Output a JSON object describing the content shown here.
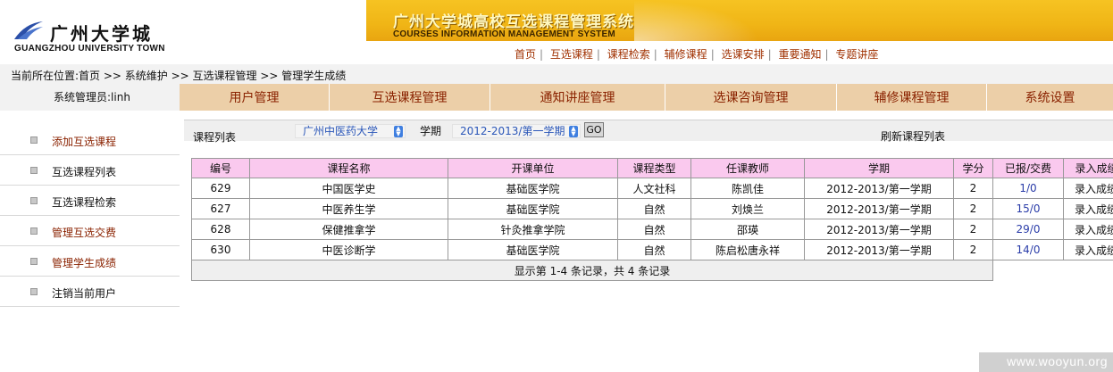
{
  "logo": {
    "cn": "广州大学城",
    "en": "GUANGZHOU UNIVERSITY TOWN"
  },
  "system": {
    "title": "广州大学城高校互选课程管理系统",
    "subtitle": "COURSES INFORMATION MANAGEMENT SYSTEM"
  },
  "top_nav": [
    "首页",
    "互选课程",
    "课程检索",
    "辅修课程",
    "选课安排",
    "重要通知",
    "专题讲座"
  ],
  "breadcrumb": "当前所在位置:首页 >> 系统维护 >> 互选课程管理 >> 管理学生成绩",
  "admin_label": "系统管理员:linh",
  "sidebar": {
    "items": [
      {
        "label": "添加互选课程"
      },
      {
        "label": "互选课程列表"
      },
      {
        "label": "互选课程检索"
      },
      {
        "label": "管理互选交费"
      },
      {
        "label": "管理学生成绩"
      },
      {
        "label": "注销当前用户"
      }
    ]
  },
  "main_tabs": [
    "用户管理",
    "互选课程管理",
    "通知讲座管理",
    "选课咨询管理",
    "辅修课程管理",
    "系统设置"
  ],
  "filter": {
    "list_label": "课程列表",
    "school_value": "广州中医药大学",
    "term_label": "学期",
    "term_value": "2012-2013/第一学期",
    "go_label": "GO",
    "refresh_label": "刷新课程列表"
  },
  "table": {
    "headers": [
      "编号",
      "课程名称",
      "开课单位",
      "课程类型",
      "任课教师",
      "学期",
      "学分",
      "已报/交费",
      "录入成绩"
    ],
    "rows": [
      [
        "629",
        "中国医学史",
        "基础医学院",
        "人文社科",
        "陈凯佳",
        "2012-2013/第一学期",
        "2",
        "1/0",
        "录入成绩"
      ],
      [
        "627",
        "中医养生学",
        "基础医学院",
        "自然",
        "刘焕兰",
        "2012-2013/第一学期",
        "2",
        "15/0",
        "录入成绩"
      ],
      [
        "628",
        "保健推拿学",
        "针灸推拿学院",
        "自然",
        "邵瑛",
        "2012-2013/第一学期",
        "2",
        "29/0",
        "录入成绩"
      ],
      [
        "630",
        "中医诊断学",
        "基础医学院",
        "自然",
        "陈启松唐永祥",
        "2012-2013/第一学期",
        "2",
        "14/0",
        "录入成绩"
      ]
    ],
    "footer": "显示第 1-4 条记录，共 4 条记录"
  },
  "watermark": "www.wooyun.org",
  "colors": {
    "banner": "#f0b516",
    "tab_bg": "#eccfa8",
    "tab_text": "#8a2200",
    "header_row": "#fac9ee",
    "link": "#2a3ca8"
  }
}
